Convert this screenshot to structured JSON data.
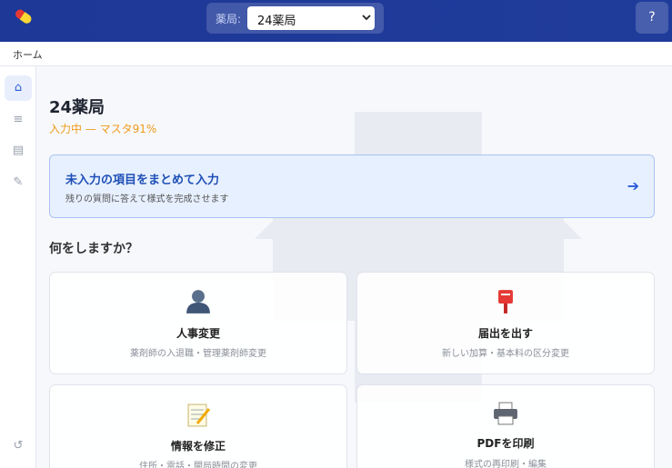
{
  "header": {
    "pharmacy_label": "薬局:",
    "pharmacy_selected": "24薬局",
    "help_label": "?"
  },
  "breadcrumb": {
    "home": "ホーム"
  },
  "sidebar": {
    "items": [
      {
        "icon": "home-icon",
        "glyph": "⌂"
      },
      {
        "icon": "list-icon",
        "glyph": "≡"
      },
      {
        "icon": "document-icon",
        "glyph": "▤"
      },
      {
        "icon": "pencil-icon",
        "glyph": "✎"
      }
    ],
    "bottom": {
      "icon": "undo-icon",
      "glyph": "↺"
    }
  },
  "main": {
    "title": "24薬局",
    "progress": "入力中 — マスタ91%",
    "banner": {
      "title": "未入力の項目をまとめて入力",
      "subtitle": "残りの質問に答えて様式を完成させます",
      "arrow": "➔"
    },
    "section_title": "何をしますか？",
    "cards": [
      {
        "icon": "person-icon",
        "title": "人事変更",
        "subtitle": "薬剤師の入退職・管理薬剤師変更"
      },
      {
        "icon": "postbox-icon",
        "title": "届出を出す",
        "subtitle": "新しい加算・基本料の区分変更"
      },
      {
        "icon": "memo-icon",
        "title": "情報を修正",
        "subtitle": "住所・電話・開局時間の変更"
      },
      {
        "icon": "printer-icon",
        "title": "PDFを印刷",
        "subtitle": "様式の再印刷・編集"
      }
    ]
  },
  "colors": {
    "header": "#1d3896",
    "accent": "#2b5bd7",
    "progress": "#ef9b1c",
    "banner_bg": "#e7f0fe"
  }
}
